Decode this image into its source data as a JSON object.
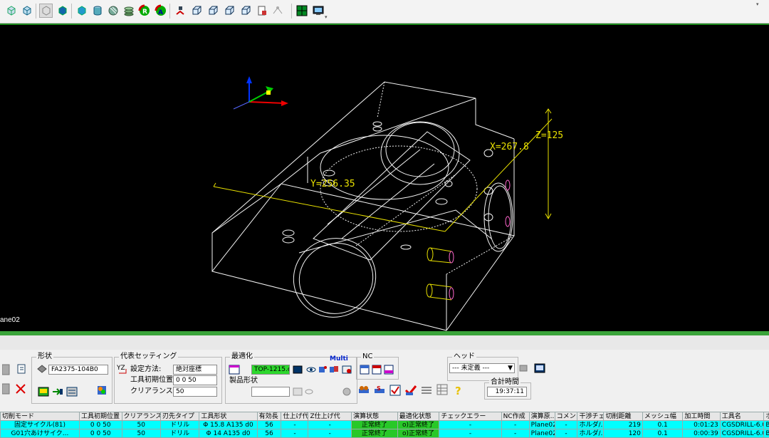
{
  "viewport": {
    "dims": {
      "x": "X=267.8",
      "y": "Y=256.35",
      "z": "Z=125"
    },
    "plane_label": "ane02"
  },
  "toolbar": {
    "icons": [
      "cube-view-icon",
      "cube-wire-icon",
      "cube-shaded-icon",
      "cube-solid-icon",
      "cube-blue-icon",
      "cylinder-icon",
      "sphere-icon",
      "layers-icon",
      "rotate-r-icon",
      "rotate-a-icon",
      "model-move-icon",
      "view-front-icon",
      "view-top-icon",
      "view-side-icon",
      "view-iso-icon",
      "document-icon",
      "dimension-icon",
      "grid-icon",
      "monitor-icon"
    ]
  },
  "shape": {
    "title": "形状",
    "value": "FA2375-104B0"
  },
  "rep_setting": {
    "title": "代表セッティング",
    "method_label": "設定方法:",
    "method_value": "絶対座標",
    "init_label": "工具初期位置:",
    "init_value": "0 0 50",
    "clearance_label": "クリアランスZ:",
    "clearance_value": "50"
  },
  "optimize": {
    "title": "最適化",
    "multi_label": "Multi",
    "file_value": "TOP-1215.cy",
    "product_title": "製品形状"
  },
  "nc": {
    "title": "NC"
  },
  "head": {
    "title": "ヘッド",
    "select_value": "--- 未定義 ---",
    "total_time_title": "合計時間",
    "total_time_value": "19:37:11"
  },
  "table": {
    "columns": [
      "切削モード",
      "工具初期位置",
      "クリアランス...",
      "刃先タイプ",
      "工具形状",
      "有効長",
      "仕上げ代",
      "Z仕上げ代",
      "演算状態",
      "最適化状態",
      "チェックエラー",
      "NC作成",
      "演算原...",
      "コメント",
      "干渉チェ...",
      "切削距離",
      "メッシュ幅",
      "加工時間",
      "工具名",
      "ホ"
    ],
    "rows": [
      [
        "固定サイクル(81)",
        "0 0 50",
        "50",
        "ドリル",
        "Φ 15.8 A135 d0",
        "56",
        "-",
        "-",
        "正常終了",
        "o)正常終了",
        "-",
        "-",
        "Plane02",
        "-",
        "ホルダ/...",
        "219",
        "0.1",
        "0:01:23",
        "CGSDRILL-6.0",
        "BT"
      ],
      [
        "G01穴あけサイク...",
        "0 0 50",
        "50",
        "ドリル",
        "Φ 14 A135 d0",
        "56",
        "-",
        "-",
        "正常終了",
        "o)正常終了",
        "-",
        "-",
        "Plane02",
        "-",
        "ホルダ/...",
        "120",
        "0.1",
        "0:00:39",
        "CGSDRILL-6.0",
        "BT"
      ]
    ]
  },
  "colors": {
    "accent_green": "#3aa43a",
    "row_cyan": "#00ffff",
    "ok_green": "#28c828",
    "dim_yellow": "#e8e000"
  }
}
